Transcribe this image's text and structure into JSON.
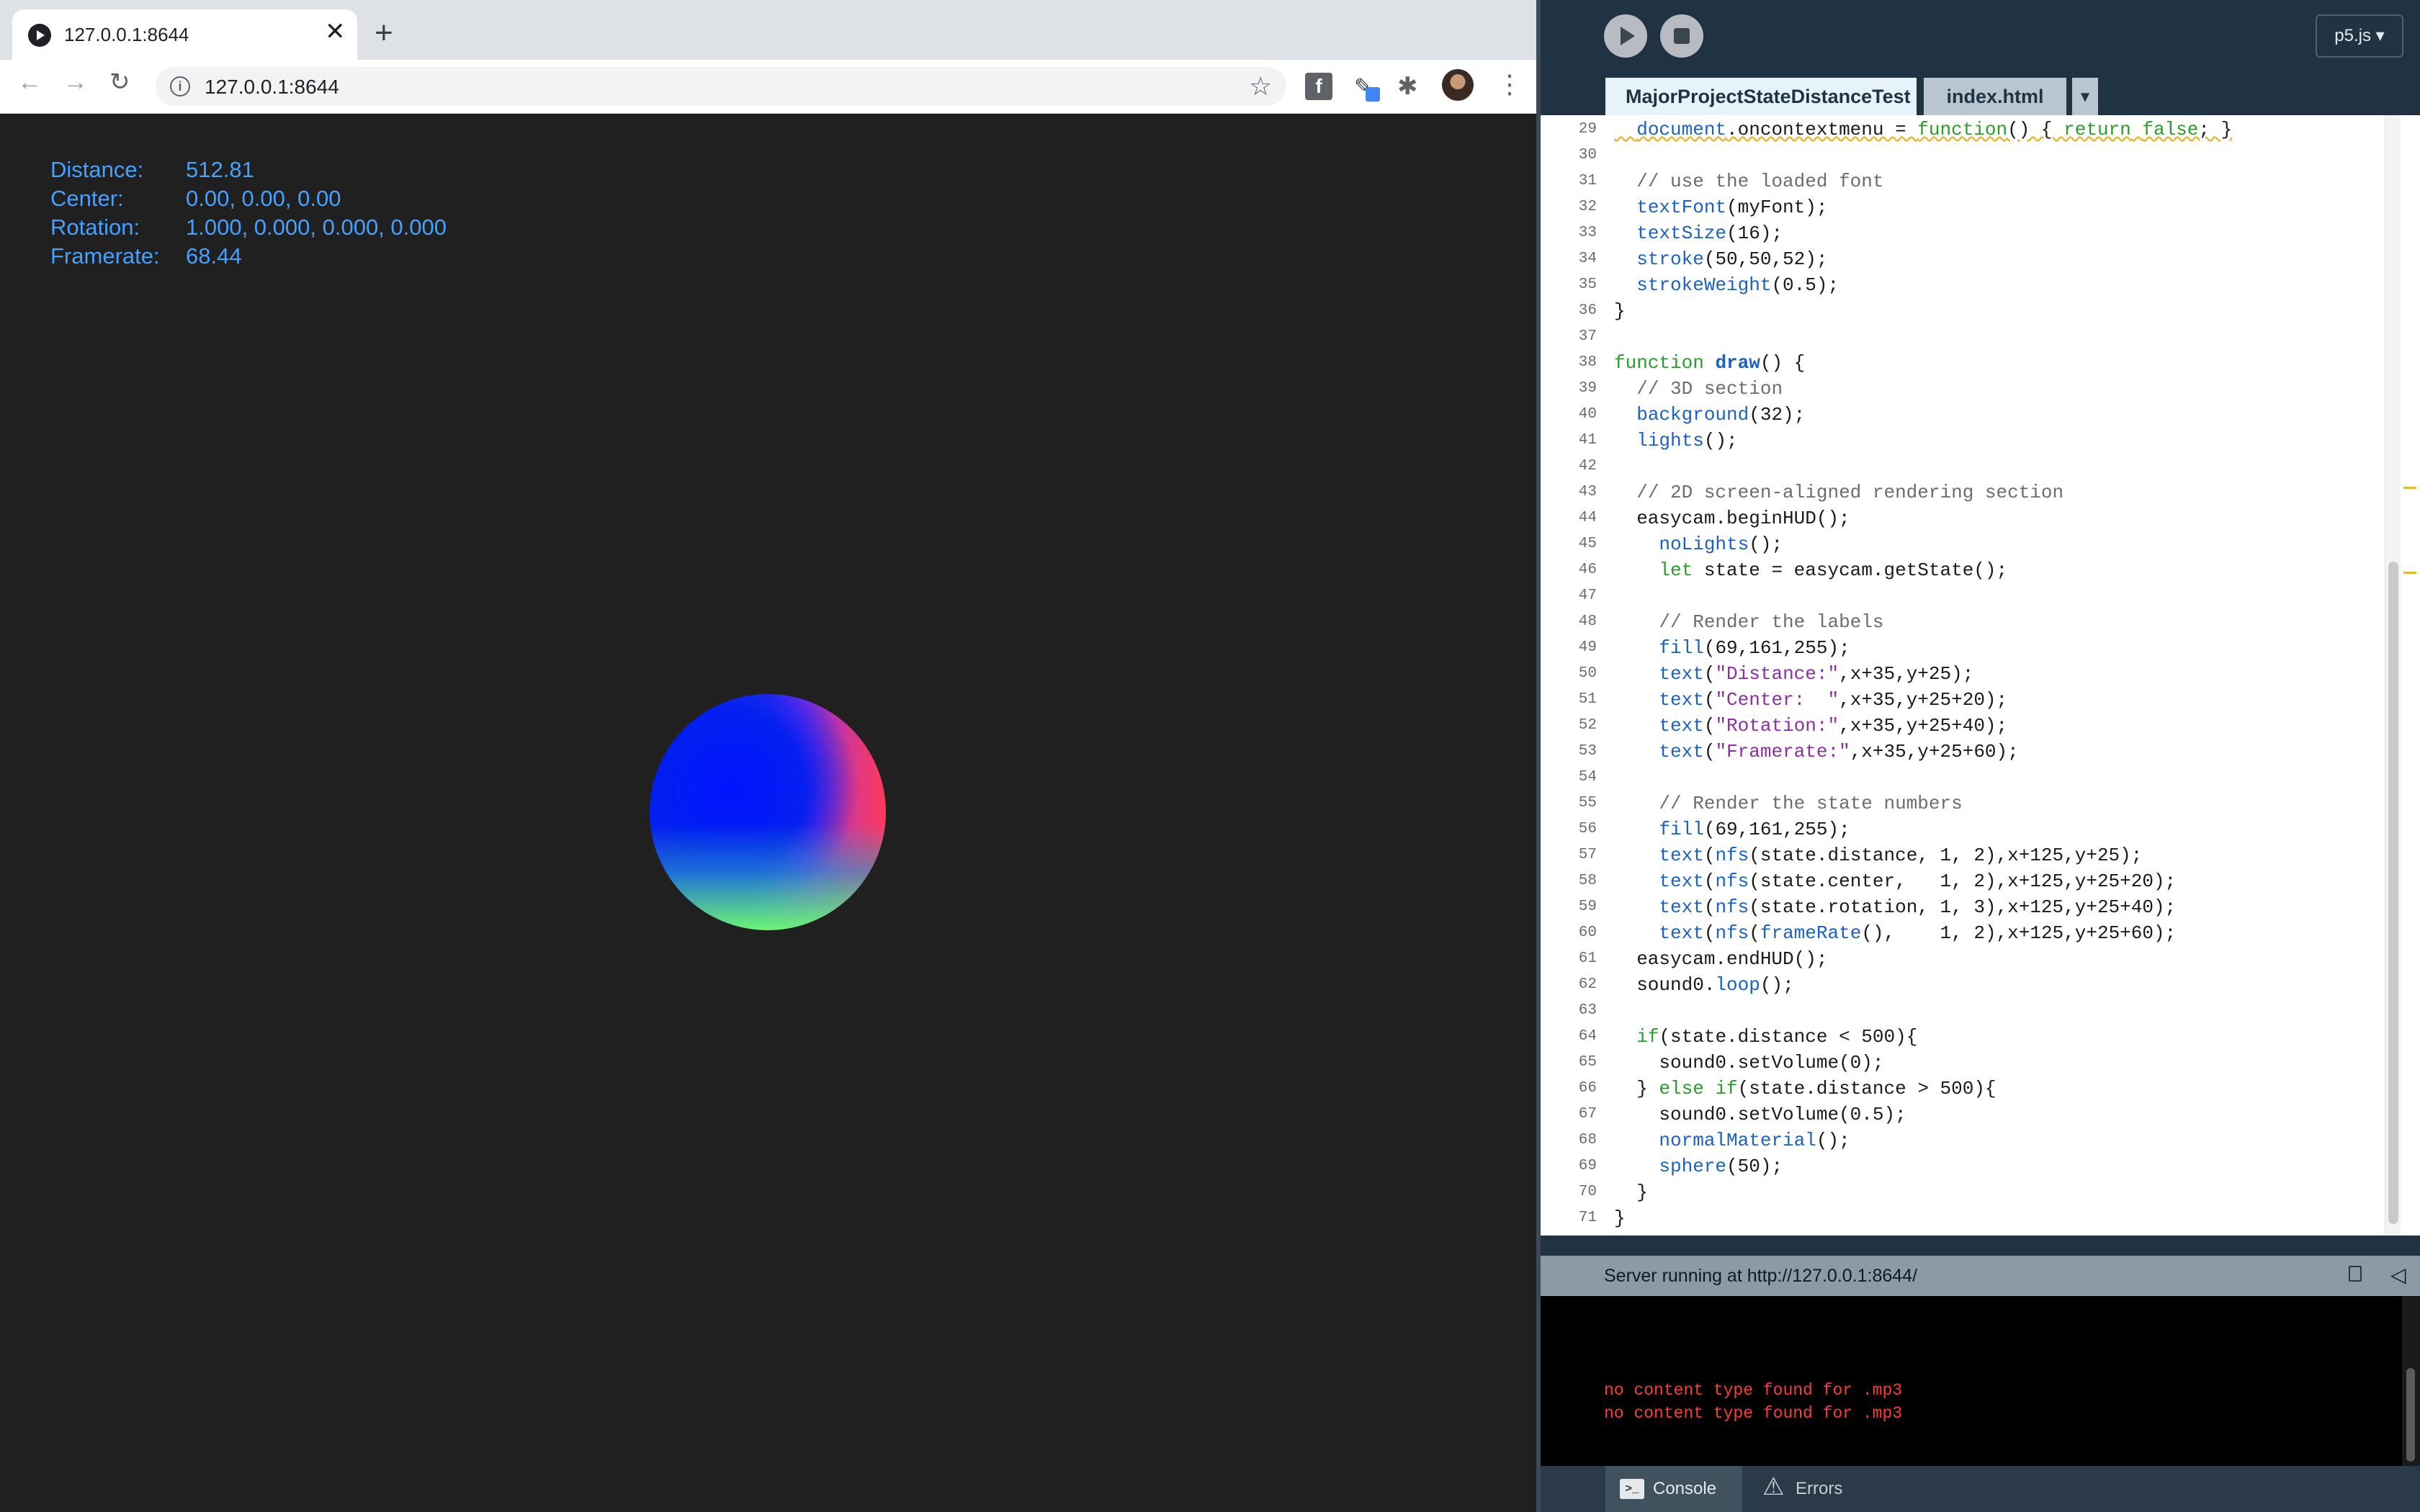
{
  "browser": {
    "tab_title": "127.0.0.1:8644",
    "tab_close": "✕",
    "new_tab": "+",
    "url": "127.0.0.1:8644",
    "back": "←",
    "forward": "→",
    "reload": "↻",
    "star": "☆",
    "ext_letter": "f",
    "puzzle": "✱",
    "menu": "⋮",
    "info": "i"
  },
  "hud": [
    {
      "label": "Distance:",
      "value": "512.81"
    },
    {
      "label": "Center:",
      "value": "0.00, 0.00, 0.00"
    },
    {
      "label": "Rotation:",
      "value": "1.000, 0.000, 0.000, 0.000"
    },
    {
      "label": "Framerate:",
      "value": "68.44"
    }
  ],
  "editor": {
    "mode": "p5.js ▾",
    "tabs": [
      "MajorProjectStateDistanceTest",
      "index.html"
    ],
    "tab_more": "▾",
    "code": [
      {
        "n": "29",
        "t": "  document.oncontextmenu = function() { return false; }"
      },
      {
        "n": "30",
        "t": ""
      },
      {
        "n": "31",
        "t": "  // use the loaded font"
      },
      {
        "n": "32",
        "t": "  textFont(myFont);"
      },
      {
        "n": "33",
        "t": "  textSize(16);"
      },
      {
        "n": "34",
        "t": "  stroke(50,50,52);"
      },
      {
        "n": "35",
        "t": "  strokeWeight(0.5);"
      },
      {
        "n": "36",
        "t": "}"
      },
      {
        "n": "37",
        "t": ""
      },
      {
        "n": "38",
        "t": "function draw() {"
      },
      {
        "n": "39",
        "t": "  // 3D section"
      },
      {
        "n": "40",
        "t": "  background(32);"
      },
      {
        "n": "41",
        "t": "  lights();"
      },
      {
        "n": "42",
        "t": ""
      },
      {
        "n": "43",
        "t": "  // 2D screen-aligned rendering section"
      },
      {
        "n": "44",
        "t": "  easycam.beginHUD();"
      },
      {
        "n": "45",
        "t": "    noLights();"
      },
      {
        "n": "46",
        "t": "    let state = easycam.getState();"
      },
      {
        "n": "47",
        "t": ""
      },
      {
        "n": "48",
        "t": "    // Render the labels"
      },
      {
        "n": "49",
        "t": "    fill(69,161,255);"
      },
      {
        "n": "50",
        "t": "    text(\"Distance:\",x+35,y+25);"
      },
      {
        "n": "51",
        "t": "    text(\"Center:  \",x+35,y+25+20);"
      },
      {
        "n": "52",
        "t": "    text(\"Rotation:\",x+35,y+25+40);"
      },
      {
        "n": "53",
        "t": "    text(\"Framerate:\",x+35,y+25+60);"
      },
      {
        "n": "54",
        "t": ""
      },
      {
        "n": "55",
        "t": "    // Render the state numbers"
      },
      {
        "n": "56",
        "t": "    fill(69,161,255);"
      },
      {
        "n": "57",
        "t": "    text(nfs(state.distance, 1, 2),x+125,y+25);"
      },
      {
        "n": "58",
        "t": "    text(nfs(state.center,   1, 2),x+125,y+25+20);"
      },
      {
        "n": "59",
        "t": "    text(nfs(state.rotation, 1, 3),x+125,y+25+40);"
      },
      {
        "n": "60",
        "t": "    text(nfs(frameRate(),    1, 2),x+125,y+25+60);"
      },
      {
        "n": "61",
        "t": "  easycam.endHUD();"
      },
      {
        "n": "62",
        "t": "  sound0.loop();"
      },
      {
        "n": "63",
        "t": ""
      },
      {
        "n": "64",
        "t": "  if(state.distance < 500){"
      },
      {
        "n": "65",
        "t": "    sound0.setVolume(0);"
      },
      {
        "n": "66",
        "t": "  } else if(state.distance > 500){"
      },
      {
        "n": "67",
        "t": "    sound0.setVolume(0.5);"
      },
      {
        "n": "68",
        "t": "    normalMaterial();"
      },
      {
        "n": "69",
        "t": "    sphere(50);"
      },
      {
        "n": "70",
        "t": "  }"
      },
      {
        "n": "71",
        "t": "}"
      }
    ]
  },
  "console": {
    "status": "Server running at http://127.0.0.1:8644/",
    "collapse": "◁",
    "messages": [
      "no content type found for .mp3",
      "no content type found for .mp3"
    ],
    "tab_console": "Console",
    "console_icon": ">_",
    "tab_errors": "Errors",
    "errors_icon": "⚠"
  }
}
